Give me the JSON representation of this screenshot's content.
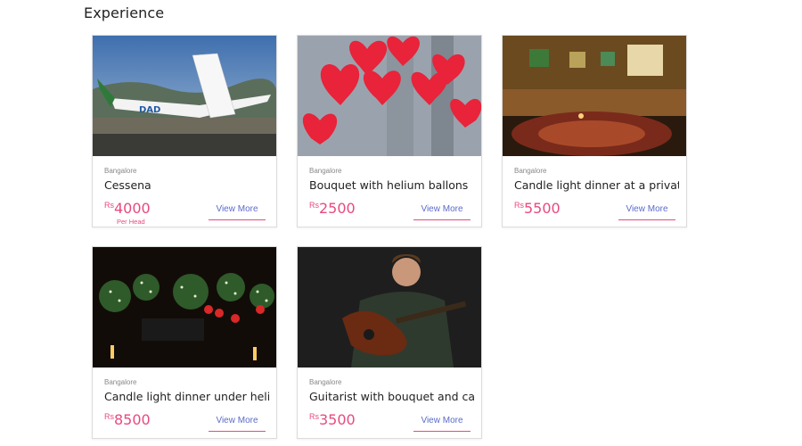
{
  "section": {
    "title": "Experience"
  },
  "cards": [
    {
      "city": "Bangalore",
      "title": "Cessena",
      "currency": "Rs",
      "price": "4000",
      "per": "Per Head",
      "more": "View More",
      "img": "airplane"
    },
    {
      "city": "Bangalore",
      "title": "Bouquet with helium ballons",
      "currency": "Rs",
      "price": "2500",
      "per": "",
      "more": "View More",
      "img": "heart-balloons"
    },
    {
      "city": "Bangalore",
      "title": "Candle light dinner at a privat...",
      "currency": "Rs",
      "price": "5500",
      "per": "",
      "more": "View More",
      "img": "private-dining-room"
    },
    {
      "city": "Bangalore",
      "title": "Candle light dinner under heli...",
      "currency": "Rs",
      "price": "8500",
      "per": "",
      "more": "View More",
      "img": "candle-dinner-lights"
    },
    {
      "city": "Bangalore",
      "title": "Guitarist with bouquet and ca...",
      "currency": "Rs",
      "price": "3500",
      "per": "",
      "more": "View More",
      "img": "guitarist"
    }
  ],
  "colors": {
    "price": "#e84a7f",
    "link": "#5b6bc9",
    "underline": "#e84a7f"
  }
}
